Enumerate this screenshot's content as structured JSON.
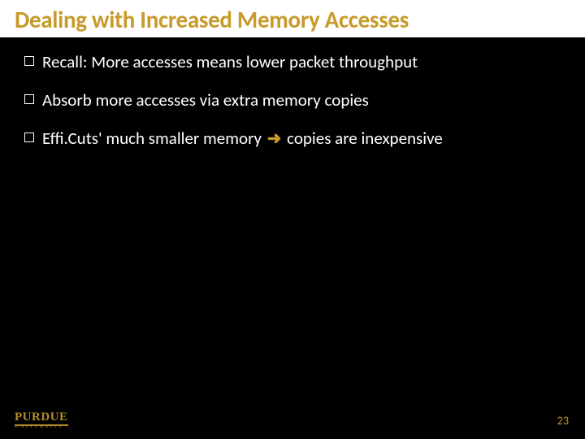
{
  "title": "Dealing with Increased Memory Accesses",
  "bullets": {
    "b0": "Recall: More accesses means lower packet throughput",
    "b1": "Absorb more accesses via extra memory copies",
    "b2a": "Effi.Cuts' much smaller memory ",
    "b2b": " copies are inexpensive"
  },
  "logo": {
    "name": "PURDUE",
    "sub": "UNIVERSITY"
  },
  "page": "23"
}
